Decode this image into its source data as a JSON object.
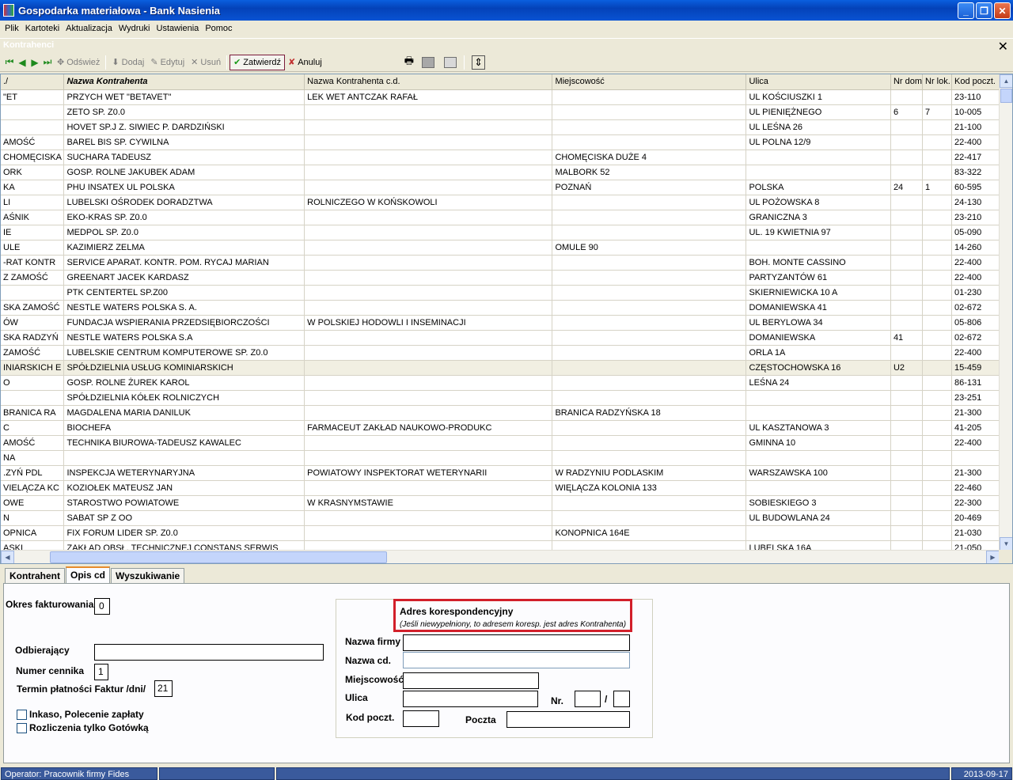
{
  "window": {
    "title": "Gospodarka materiałowa - Bank Nasienia"
  },
  "menu": [
    "Plik",
    "Kartoteki",
    "Aktualizacja",
    "Wydruki",
    "Ustawienia",
    "Pomoc"
  ],
  "child": {
    "title": "Kontrahenci"
  },
  "toolbar": {
    "refresh": "Odśwież",
    "add": "Dodaj",
    "edit": "Edytuj",
    "delete": "Usuń",
    "confirm": "Zatwierdź",
    "cancel": "Anuluj"
  },
  "grid": {
    "columns": [
      "./",
      "Nazwa Kontrahenta",
      "Nazwa Kontrahenta c.d.",
      "Miejscowość",
      "Ulica",
      "Nr dom",
      "Nr lok.",
      "Kod poczt."
    ],
    "rows": [
      [
        "ET\"",
        "PRZYCH WET \"BETAVET\"",
        "LEK WET ANTCZAK RAFAŁ",
        "",
        "UL KOŚCIUSZKI 1",
        "",
        "",
        "23-110"
      ],
      [
        "",
        "ZETO SP. Z0.0",
        "",
        "",
        "UL PIENIĘŻNEGO",
        "6",
        "7",
        "10-005"
      ],
      [
        "",
        "HOVET SP.J Z. SIWIEC P. DARDZIŃSKI",
        "",
        "",
        "UL LEŚNA 26",
        "",
        "",
        "21-100"
      ],
      [
        "AMOŚĆ",
        "BAREL BIS SP. CYWILNA",
        "",
        "",
        "UL POLNA 12/9",
        "",
        "",
        "22-400"
      ],
      [
        "CHOMĘCISKA",
        "SUCHARA TADEUSZ",
        "",
        "CHOMĘCISKA DUŻE 4",
        "",
        "",
        "",
        "22-417"
      ],
      [
        "ORK",
        "GOSP. ROLNE JAKUBEK ADAM",
        "",
        "MALBORK 52",
        "",
        "",
        "",
        "83-322"
      ],
      [
        "KA",
        "PHU INSATEX UL POLSKA",
        "",
        "POZNAŃ",
        "POLSKA",
        "24",
        "1",
        "60-595"
      ],
      [
        "LI",
        "LUBELSKI OŚRODEK DORADZTWA",
        "ROLNICZEGO W KOŃSKOWOLI",
        "",
        "UL POŻOWSKA 8",
        "",
        "",
        "24-130"
      ],
      [
        "AŚNIK",
        "EKO-KRAS SP. Z0.0",
        "",
        "",
        "GRANICZNA 3",
        "",
        "",
        "23-210"
      ],
      [
        "IE",
        "MEDPOL SP. Z0.0",
        "",
        "",
        "UL. 19 KWIETNIA 97",
        "",
        "",
        "05-090"
      ],
      [
        "ULE",
        "KAZIMIERZ ZELMA",
        "",
        "OMULE 90",
        "",
        "",
        "",
        "14-260"
      ],
      [
        "RAT KONTR-",
        "SERVICE APARAT. KONTR. POM. RYCAJ MARIAN",
        "",
        "",
        "BOH. MONTE CASSINO",
        "",
        "",
        "22-400"
      ],
      [
        "Z ZAMOŚĆ",
        "GREENART JACEK KARDASZ",
        "",
        "",
        "PARTYZANTÓW 61",
        "",
        "",
        "22-400"
      ],
      [
        "",
        "PTK CENTERTEL SP.Z00",
        "",
        "",
        "SKIERNIEWICKA 10 A",
        "",
        "",
        "01-230"
      ],
      [
        "SKA ZAMOŚĆ",
        "NESTLE WATERS POLSKA S. A.",
        "",
        "",
        "DOMANIEWSKA 41",
        "",
        "",
        "02-672"
      ],
      [
        "ÓW",
        "FUNDACJA WSPIERANIA PRZEDSIĘBIORCZOŚCI",
        "W POLSKIEJ HODOWLI I INSEMINACJI",
        "",
        "UL BERYLOWA 34",
        "",
        "",
        "05-806"
      ],
      [
        "SKA RADZYŃ",
        "NESTLE WATERS POLSKA S.A",
        "",
        "",
        "DOMANIEWSKA",
        "41",
        "",
        "02-672"
      ],
      [
        "ZAMOŚĆ",
        "LUBELSKIE CENTRUM KOMPUTEROWE SP. Z0.0",
        "",
        "",
        "ORLA 1A",
        "",
        "",
        "22-400"
      ],
      [
        "INIARSKICH E",
        "SPÓŁDZIELNIA USŁUG KOMINIARSKICH",
        "",
        "",
        "CZĘSTOCHOWSKA 16",
        "U2",
        "",
        "15-459"
      ],
      [
        "O",
        "GOSP. ROLNE ŻUREK KAROL",
        "",
        "",
        "LEŚNA 24",
        "",
        "",
        "86-131"
      ],
      [
        "",
        "SPÓŁDZIELNIA KÓŁEK ROLNICZYCH",
        "",
        "",
        "",
        "",
        "",
        "23-251"
      ],
      [
        "BRANICA RA",
        "MAGDALENA MARIA DANILUK",
        "",
        "BRANICA RADZYŃSKA 18",
        "",
        "",
        "",
        "21-300"
      ],
      [
        "C",
        "BIOCHEFA",
        "FARMACEUT ZAKŁAD NAUKOWO-PRODUKC",
        "",
        "UL KASZTANOWA 3",
        "",
        "",
        "41-205"
      ],
      [
        "AMOŚĆ",
        "TECHNIKA BIUROWA-TADEUSZ KAWALEC",
        "",
        "",
        "GMINNA 10",
        "",
        "",
        "22-400"
      ],
      [
        "NA",
        "",
        "",
        "",
        "",
        "",
        "",
        ""
      ],
      [
        "ZYŃ PDL.",
        "INSPEKCJA WETERYNARYJNA",
        "POWIATOWY INSPEKTORAT WETERYNARII",
        "W RADZYNIU PODLASKIM",
        "WARSZAWSKA 100",
        "",
        "",
        "21-300"
      ],
      [
        "VIELĄCZA KC",
        "KOZIOŁEK MATEUSZ JAN",
        "",
        "WIĘLĄCZA KOLONIA 133",
        "",
        "",
        "",
        "22-460"
      ],
      [
        "OWE",
        "STAROSTWO POWIATOWE",
        "W KRASNYMSTAWIE",
        "",
        "SOBIESKIEGO 3",
        "",
        "",
        "22-300"
      ],
      [
        "N",
        "SABAT SP Z OO",
        "",
        "",
        "UL BUDOWLANA 24",
        "",
        "",
        "20-469"
      ],
      [
        "OPNICA",
        "FIX FORUM LIDER SP. Z0.0",
        "",
        "KONOPNICA 164E",
        "",
        "",
        "",
        "21-030"
      ],
      [
        "ASKI",
        "ZAKŁAD OBSŁ. TECHNICZNEJ CONSTANS SERWIS",
        "",
        "",
        "LUBELSKA 16A",
        "",
        "",
        "21-050"
      ]
    ]
  },
  "tabs": [
    "Kontrahent",
    "Opis cd",
    "Wyszukiwanie"
  ],
  "form": {
    "okres_label": "Okres fakturowania",
    "okres_value": "0",
    "odbierajacy_label": "Odbierający",
    "numer_cennika_label": "Numer cennika",
    "numer_cennika_value": "1",
    "termin_label": "Termin płatności Faktur /dni/",
    "termin_value": "21",
    "inkaso_label": "Inkaso, Polecenie zapłaty",
    "gotowka_label": "Rozliczenia tylko Gotówką",
    "adres_title": "Adres korespondencyjny",
    "adres_note": "(Jeśli niewypełniony, to adresem koresp. jest adres Kontrahenta)",
    "nazwa_firmy_label": "Nazwa firmy",
    "nazwa_cd_label": "Nazwa cd.",
    "miejscowosc_label": "Miejscowość",
    "ulica_label": "Ulica",
    "nr_label": "Nr.",
    "slash": "/",
    "kod_label": "Kod poczt.",
    "poczta_label": "Poczta"
  },
  "status": {
    "operator": "Operator: Pracownik firmy Fides",
    "date": "2013-09-17"
  }
}
